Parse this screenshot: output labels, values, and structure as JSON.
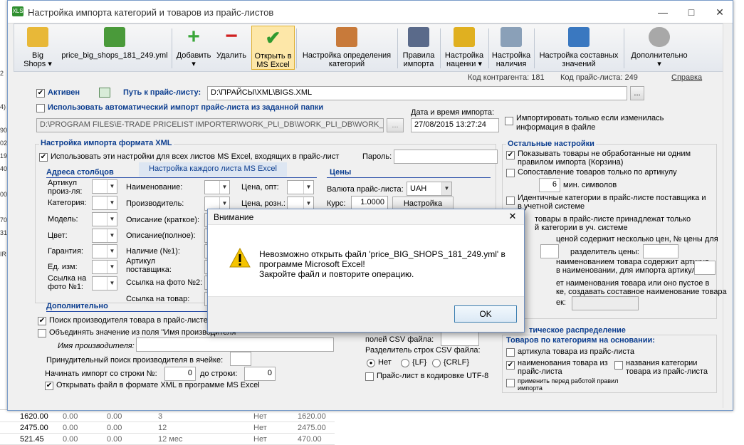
{
  "window": {
    "title": "Настройка импорта категорий и товаров из прайс-листов",
    "app_icon": "XLS",
    "minimize": "—",
    "maximize": "□",
    "close": "✕"
  },
  "toolbar": {
    "items": [
      {
        "label": "Big\nShops ▾",
        "icon": "truck-icon"
      },
      {
        "label": "price_big_shops_181_249.yml",
        "icon": "xls-file-icon"
      },
      {
        "label": "Добавить\n▾",
        "icon": "plus-icon"
      },
      {
        "label": "Удалить",
        "icon": "minus-icon"
      },
      {
        "label": "Открыть в\nMS Excel",
        "icon": "checkmark-icon"
      },
      {
        "label": "Настройка определения\nкатегорий",
        "icon": "category-settings-icon"
      },
      {
        "label": "Правила\nимпорта",
        "icon": "feather-icon"
      },
      {
        "label": "Настройка\nнаценки ▾",
        "icon": "coins-icon"
      },
      {
        "label": "Настройка\nналичия",
        "icon": "cart-icon"
      },
      {
        "label": "Настройка составных\nзначений",
        "icon": "laptop-icon"
      },
      {
        "label": "Дополнительно\n▾",
        "icon": "gear-icon"
      }
    ]
  },
  "status": {
    "contractor_code": "Код контрагента: 181",
    "pricelist_code": "Код прайс-листа: 249",
    "help": "Справка"
  },
  "top": {
    "active_label": "Активен",
    "path_label": "Путь к прайс-листу:",
    "path_value": "D:\\ПРАЙСЫ\\XML\\BIGS.XML",
    "browse": "...",
    "auto_import_label": "Использовать автоматический импорт прайс-листа из заданной папки",
    "auto_path": "D:\\PROGRAM FILES\\E-TRADE PRICELIST IMPORTER\\WORK_PLI_DB\\WORK_PLI_DB\\WORK_PLI_DB\\",
    "datetime_label": "Дата и время импорта:",
    "datetime_value": "27/08/2015 13:27:24",
    "only_changed": "Импортировать только если изменилась информация в файле"
  },
  "xml": {
    "title": "Настройка импорта формата XML",
    "use_for_all": "Использовать эти настройки для всех листов MS Excel, входящих в прайс-лист",
    "password": "Пароль:",
    "per_sheet": "Настройка каждого листа MS Excel",
    "columns_title": "Адреса столбцов",
    "prices_title": "Цены",
    "col1": [
      "Артикул произ-ля:",
      "Категория:",
      "Модель:",
      "Цвет:",
      "Гарантия:",
      "Ед. изм:",
      "Ссылка на фото №1:"
    ],
    "col2": [
      "Наименование:",
      "Производитель:",
      "Описание (краткое):",
      "Описание(полное):",
      "Наличие (№1):",
      "Артикул поставщика:",
      "Ссылка на фото №2:",
      "Ссылка на товар:"
    ],
    "col3": [
      "Цена, опт:",
      "Цена, розн.:"
    ],
    "currency_label": "Валюта прайс-листа:",
    "currency_value": "UAH",
    "rate_label": "Курс:",
    "rate_value": "1.0000",
    "rate_btn": "Настройка"
  },
  "extra": {
    "title": "Дополнительно",
    "search_manuf": "Поиск производителя товара в прайс-листе",
    "merge": "Объединять значение из поля \"Имя производителя\"",
    "manuf_name": "Имя производителя:",
    "forced_search": "Принудительный поиск производителя в ячейке:",
    "start_row_label": "Начинать импорт со строки №:",
    "start_row_value": "0",
    "to_row_label": "до строки:",
    "to_row_value": "0",
    "open_xml": "Открывать файл в формате XML в программе MS Excel"
  },
  "csv": {
    "fields_label": "полей CSV файла:",
    "sep_label": "Разделитель строк CSV файла:",
    "opt_no": "Нет",
    "opt_lf": "{LF}",
    "opt_crlf": "{CRLF}",
    "utf8": "Прайс-лист в кодировке UTF-8"
  },
  "other": {
    "title": "Остальные настройки",
    "show_unprocessed": "Показывать товары не обработанные ни одним правилом импорта (Корзина)",
    "match_article": "Сопоставление товаров только по артикулу",
    "min_chars_value": "6",
    "min_chars": "мин. символов",
    "identical_cats": "Идентичные категории в прайс-листе поставщика и в учетной системе",
    "belong_one": "товары в прайс-листе принадлежат только",
    "belong_one2": "й категории в уч. системе",
    "multi_price": "ценой содержит несколько цен, № цены для",
    "price_sep": "разделитель цены:",
    "name_contains": "наименованием товара содержит артикул,",
    "name_contains2": "в наименовании, для импорта артикула:",
    "name_empty": "ет наименования товара или оно пустое в",
    "name_empty2": "ке, создавать составное наименование товара",
    "name_empty3": "ек:"
  },
  "auto": {
    "title": "тическое распределение",
    "subtitle": "Товаров по категориям на основании:",
    "by_article": "артикула товара из прайс-листа",
    "by_name": "наименования товара из прайс-листа",
    "by_cat": "названия  категории товара из прайс-листа",
    "apply_before": "применить перед работой правил импорта"
  },
  "dialog": {
    "title": "Внимание",
    "icon": "warning-icon",
    "message": "Невозможно открыть файл 'price_BIG_SHOPS_181_249.yml' в\nпрограмме Microsoft Excel!\nЗакройте файл и повторите операцию.",
    "ok": "OK",
    "close": "✕"
  },
  "background": {
    "left_cells": [
      "2",
      "4)",
      "90",
      "02",
      "19",
      "40",
      "00",
      "70",
      "31",
      "IR"
    ],
    "rows": [
      [
        "1620.00",
        "0.00",
        "0.00",
        "3",
        "Нет",
        "1620.00"
      ],
      [
        "2475.00",
        "0.00",
        "0.00",
        "12",
        "Нет",
        "2475.00"
      ],
      [
        "521.45",
        "0.00",
        "0.00",
        "12 мес",
        "Нет",
        "470.00"
      ]
    ]
  }
}
